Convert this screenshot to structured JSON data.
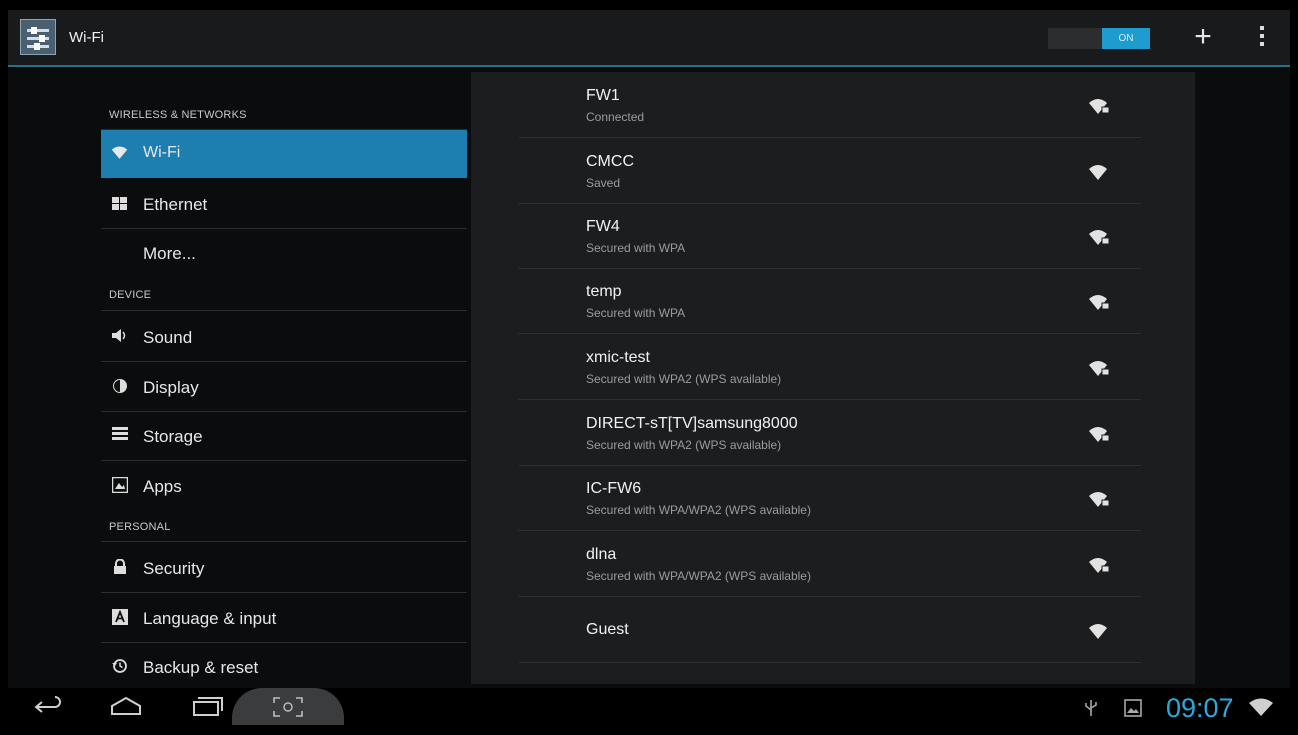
{
  "action_bar": {
    "title": "Wi-Fi",
    "toggle_label": "ON",
    "add_icon": "plus-icon",
    "overflow_icon": "overflow-menu-icon"
  },
  "sidebar": {
    "sections": [
      {
        "header": "WIRELESS & NETWORKS"
      },
      {
        "header": "DEVICE"
      },
      {
        "header": "PERSONAL"
      }
    ],
    "items": [
      {
        "label": "Wi-Fi",
        "icon": "wifi-icon",
        "active": true
      },
      {
        "label": "Ethernet",
        "icon": "ethernet-icon",
        "active": false
      },
      {
        "label": "More...",
        "icon": "",
        "active": false
      },
      {
        "label": "Sound",
        "icon": "speaker-icon",
        "active": false
      },
      {
        "label": "Display",
        "icon": "brightness-icon",
        "active": false
      },
      {
        "label": "Storage",
        "icon": "storage-icon",
        "active": false
      },
      {
        "label": "Apps",
        "icon": "apps-icon",
        "active": false
      },
      {
        "label": "Security",
        "icon": "lock-icon",
        "active": false
      },
      {
        "label": "Language & input",
        "icon": "keyboard-icon",
        "active": false
      },
      {
        "label": "Backup & reset",
        "icon": "backup-icon",
        "active": false
      }
    ]
  },
  "networks": [
    {
      "name": "FW1",
      "status": "Connected",
      "secured": true
    },
    {
      "name": "CMCC",
      "status": "Saved",
      "secured": false
    },
    {
      "name": "FW4",
      "status": "Secured with WPA",
      "secured": true
    },
    {
      "name": "temp",
      "status": "Secured with WPA",
      "secured": true
    },
    {
      "name": "xmic-test",
      "status": "Secured with WPA2 (WPS available)",
      "secured": true
    },
    {
      "name": "DIRECT-sT[TV]samsung8000",
      "status": "Secured with WPA2 (WPS available)",
      "secured": true
    },
    {
      "name": "IC-FW6",
      "status": "Secured with WPA/WPA2 (WPS available)",
      "secured": true
    },
    {
      "name": "dlna",
      "status": "Secured with WPA/WPA2 (WPS available)",
      "secured": true
    },
    {
      "name": "Guest",
      "status": "",
      "secured": false
    }
  ],
  "system_bar": {
    "clock": "09:07",
    "accent": "#2aa9dc"
  }
}
